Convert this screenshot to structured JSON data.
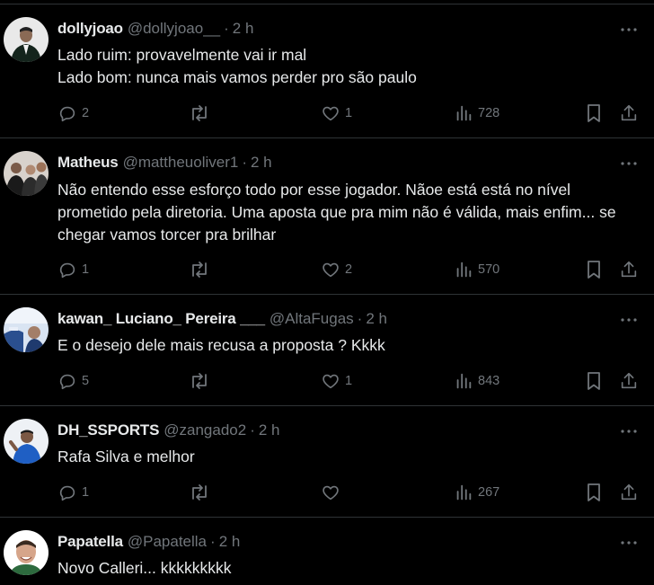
{
  "tweets": [
    {
      "name": "dollyjoao",
      "handle": "@dollyjoao__",
      "separator": "·",
      "time": "2 h",
      "text": "Lado ruim: provavelmente vai ir mal\nLado bom: nunca mais vamos perder pro são paulo",
      "replies": "2",
      "retweets": "",
      "likes": "1",
      "views": "728"
    },
    {
      "name": "Matheus",
      "handle": "@mattheuoliver1",
      "separator": "·",
      "time": "2 h",
      "text": "Não entendo esse esforço todo por esse jogador. Nãoe está   está no nível prometido pela diretoria. Uma aposta que pra mim não é válida, mais enfim... se chegar vamos torcer pra brilhar",
      "replies": "1",
      "retweets": "",
      "likes": "2",
      "views": "570"
    },
    {
      "name": "kawan_ Luciano_ Pereira ___",
      "handle": "@AltaFugas",
      "separator": "·",
      "time": "2 h",
      "text": "E o desejo dele mais recusa a proposta ? Kkkk",
      "replies": "5",
      "retweets": "",
      "likes": "1",
      "views": "843"
    },
    {
      "name": "DH_SSPORTS",
      "handle": "@zangado2",
      "separator": "·",
      "time": "2 h",
      "text": "Rafa Silva e melhor",
      "replies": "1",
      "retweets": "",
      "likes": "",
      "views": "267"
    },
    {
      "name": "Papatella",
      "handle": "@Papatella",
      "separator": "·",
      "time": "2 h",
      "text": "Novo Calleri... kkkkkkkkk",
      "replies": "",
      "retweets": "",
      "likes": "",
      "views": ""
    }
  ],
  "colors": {
    "background": "#000000",
    "text": "#e7e9ea",
    "muted": "#71767b",
    "border": "#2f3336"
  },
  "icons": [
    "reply-icon",
    "retweet-icon",
    "like-icon",
    "views-icon",
    "bookmark-icon",
    "share-icon",
    "more-icon"
  ]
}
